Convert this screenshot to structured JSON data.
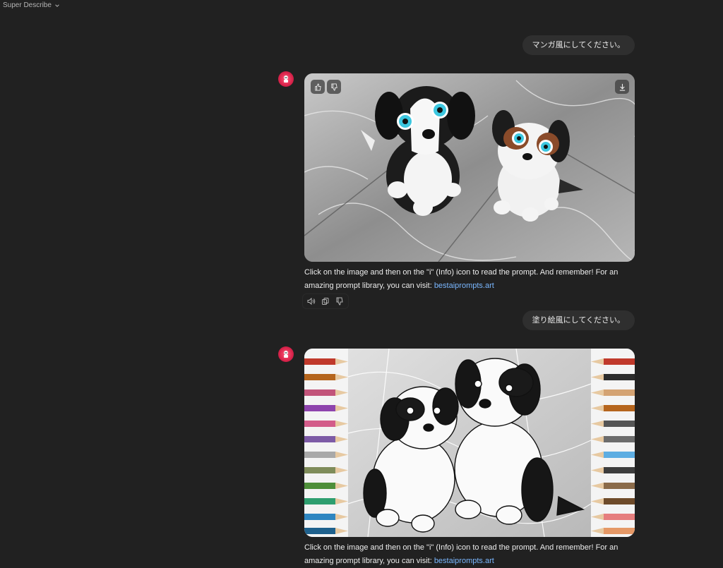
{
  "header": {
    "model_name": "Super Describe"
  },
  "messages": [
    {
      "user_text": "マンガ風にしてください。"
    },
    {
      "user_text": "塗り絵風にしてください。"
    }
  ],
  "responses": [
    {
      "caption_text": "Click on the image and then on the \"i\" (Info) icon to read the prompt. And remember! For an amazing prompt library, you can visit: ",
      "link_text": "bestaiprompts.art"
    },
    {
      "caption_text": "Click on the image and then on the \"i\" (Info) icon to read the prompt. And remember! For an amazing prompt library, you can visit: ",
      "link_text": "bestaiprompts.art"
    }
  ],
  "icons": {
    "model_chevron": "chevron-down-icon",
    "thumbs_up": "thumbs-up-icon",
    "thumbs_down": "thumbs-down-icon",
    "download": "download-icon",
    "read_aloud": "speaker-icon",
    "copy": "copy-icon"
  },
  "colors": {
    "background": "#212121",
    "bubble": "#2f2f2f",
    "link": "#7ab7ff",
    "avatar": "#d8234a"
  }
}
